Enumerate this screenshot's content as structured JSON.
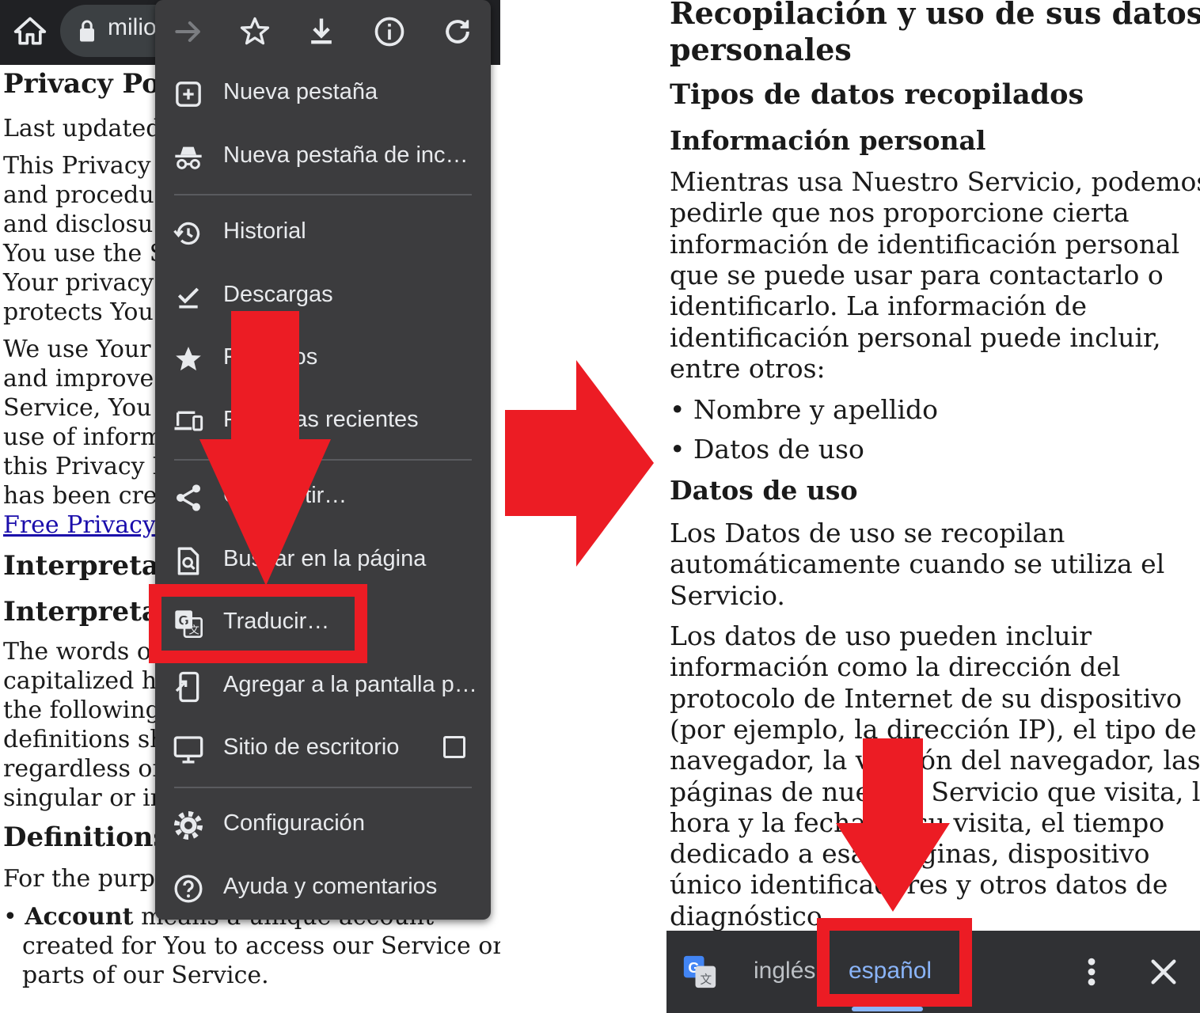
{
  "left_page": {
    "url": "milio",
    "lines": [
      {
        "text": "Privacy Po",
        "style": "heading"
      },
      {
        "text": "Last updated"
      },
      {
        "text": "This Privacy"
      },
      {
        "text": "and procedu"
      },
      {
        "text": "and disclosu"
      },
      {
        "text": "You use the S"
      },
      {
        "text": "Your privacy"
      },
      {
        "text": "protects You."
      },
      {
        "text": "We use Your"
      },
      {
        "text": "and improve"
      },
      {
        "text": "Service, You a"
      },
      {
        "text": "use of inform"
      },
      {
        "text": "this Privacy P"
      },
      {
        "text": "has been crea"
      },
      {
        "text": "Free Privacy",
        "style": "link"
      },
      {
        "text": "Interpreta",
        "style": "heading"
      },
      {
        "text": "Interpretat",
        "style": "heading"
      },
      {
        "text": "The words o"
      },
      {
        "text": "capitalized h"
      },
      {
        "text": "the following"
      },
      {
        "text": "definitions sh"
      },
      {
        "text": "regardless of"
      },
      {
        "text": "singular or in"
      },
      {
        "text": "Definitions",
        "style": "heading"
      },
      {
        "text": "For the purpo"
      }
    ],
    "bullet_term": "Account",
    "bullet_rest": " means a unique account",
    "bullet_line2": "created for You to access our Service or",
    "bullet_line3": "parts of our Service."
  },
  "menu": {
    "toolbar_icons": [
      "forward-icon",
      "bookmark-star-icon",
      "download-icon",
      "info-icon",
      "reload-icon"
    ],
    "items": [
      {
        "label": "Nueva pestaña",
        "icon": "new-tab-icon"
      },
      {
        "label": "Nueva pestaña de inc…",
        "icon": "incognito-icon"
      },
      {
        "label": "Historial",
        "icon": "history-icon"
      },
      {
        "label": "Descargas",
        "icon": "downloads-icon"
      },
      {
        "label": "Favoritos",
        "icon": "star-icon"
      },
      {
        "label": "Pestañas recientes",
        "icon": "devices-icon"
      },
      {
        "label": "Compartir…",
        "icon": "share-icon"
      },
      {
        "label": "Buscar en la página",
        "icon": "find-in-page-icon"
      },
      {
        "label": "Traducir…",
        "icon": "translate-icon"
      },
      {
        "label": "Agregar a la pantalla p…",
        "icon": "add-to-home-icon"
      },
      {
        "label": "Sitio de escritorio",
        "icon": "desktop-icon"
      },
      {
        "label": "Configuración",
        "icon": "settings-gear-icon"
      },
      {
        "label": "Ayuda y comentarios",
        "icon": "help-icon"
      }
    ]
  },
  "right_page": {
    "heading1_line1": "Recopilación y uso de sus datos",
    "heading1_line2": "personales",
    "heading2": "Tipos de datos recopilados",
    "heading3": "Información personal",
    "para1": [
      "Mientras usa Nuestro Servicio, podemos",
      "pedirle que nos proporcione cierta",
      "información de identificación personal",
      "que se puede usar para contactarlo o",
      "identificarlo. La información de",
      "identificación personal puede incluir,",
      "entre otros:"
    ],
    "bullets": [
      "Nombre y apellido",
      "Datos de uso"
    ],
    "heading4": "Datos de uso",
    "para2": [
      "Los Datos de uso se recopilan",
      "automáticamente cuando se utiliza el",
      "Servicio."
    ],
    "para3": [
      "Los datos de uso pueden incluir",
      "información como la dirección del",
      "protocolo de Internet de su dispositivo",
      "(por ejemplo, la dirección IP), el tipo de",
      "navegador, la versión del navegador, las",
      "páginas de nuestro Servicio que visita, la",
      "hora y la fecha de su visita, el tiempo",
      "dedicado a esas páginas, dispositivo",
      "único identificadores y otros datos de",
      "diagnóstico."
    ]
  },
  "translate_bar": {
    "source_lang": "inglés",
    "target_lang": "español",
    "icons": [
      "google-translate-icon",
      "more-vert-icon",
      "close-icon"
    ]
  },
  "colors": {
    "annotation_red": "#ec1c24",
    "menu_bg": "#3c3c3e",
    "toolbar_bg": "#202124",
    "translate_bar_bg": "#303134",
    "active_lang": "#8ab4f8",
    "link": "#1a0dab"
  }
}
